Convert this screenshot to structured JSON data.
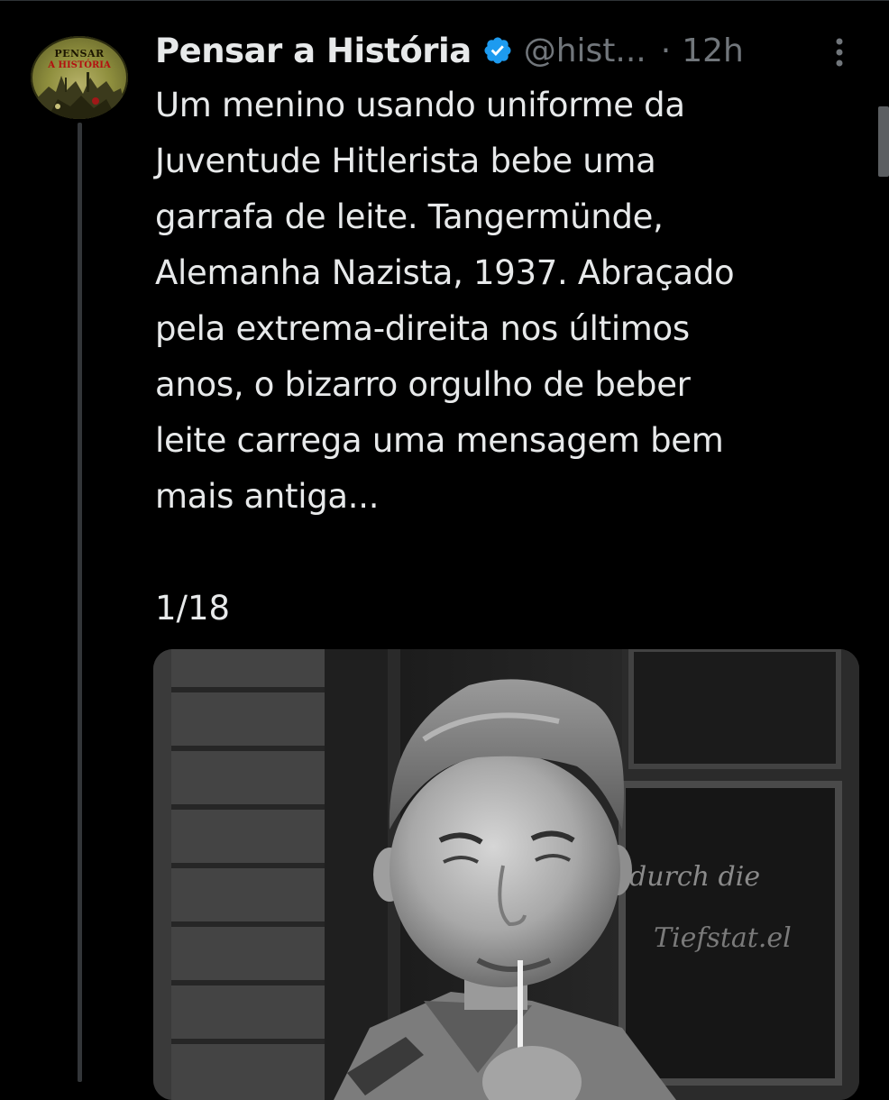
{
  "tweet": {
    "author_name": "Pensar a História",
    "handle": "@hist...",
    "separator": "·",
    "time": "12h",
    "text": "Um menino usando uniforme da\nJuventude Hitlerista bebe uma\ngarrafa de leite. Tangermünde,\nAlemanha Nazista, 1937. Abraçado\npela extrema-direita nos últimos\nanos, o bizarro orgulho de beber\nleite carrega uma mensagem bem\nmais antiga...",
    "thread_counter": "1/18"
  },
  "avatar": {
    "line1": "PENSAR",
    "line2": "A HISTÓRIA"
  },
  "icons": {
    "verified": "verified-badge-icon",
    "more": "more-options-icon"
  },
  "photo_sign": {
    "line1": "durch die",
    "line2": "Tiefstat.el"
  },
  "colors": {
    "background": "#000000",
    "text_primary": "#e7e9ea",
    "text_secondary": "#71767b",
    "verified_blue": "#1d9bf0",
    "thread_line": "#333639"
  }
}
